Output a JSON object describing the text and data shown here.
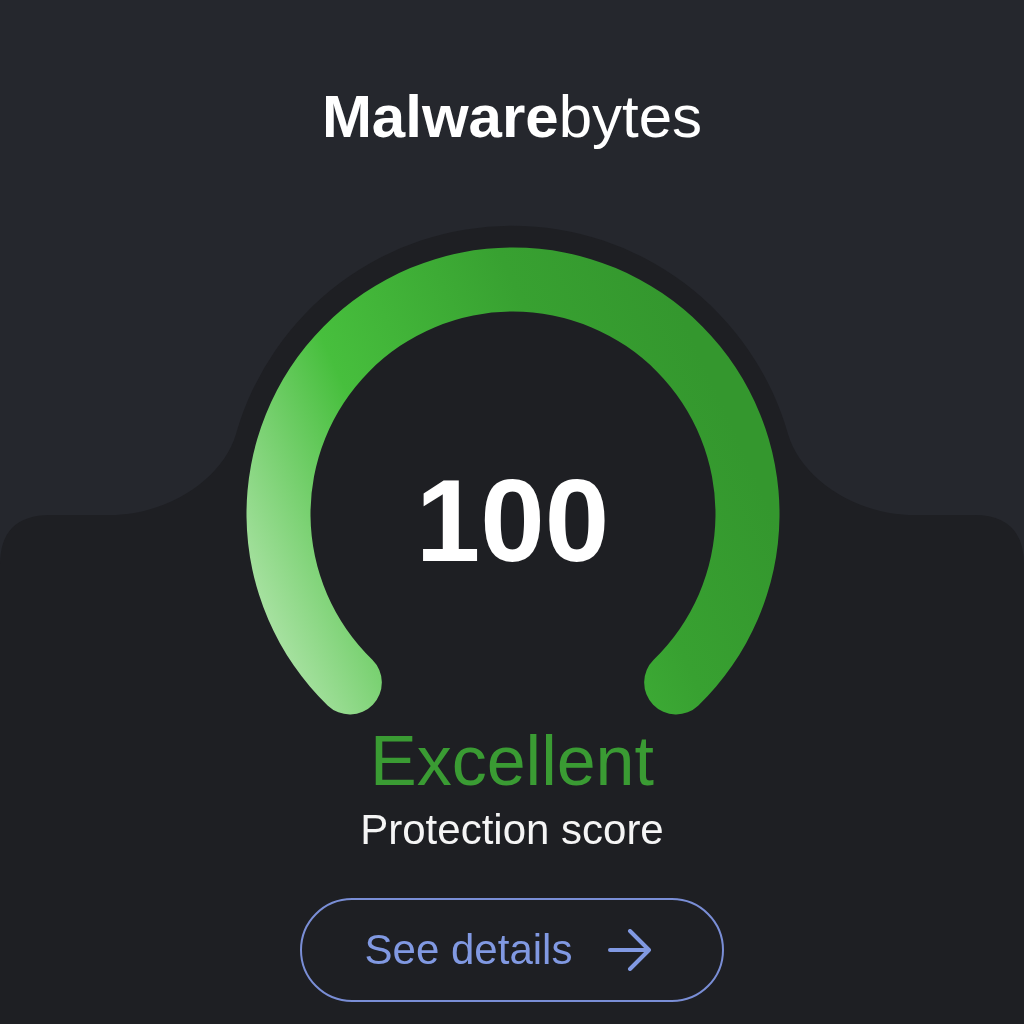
{
  "logo": {
    "wordmark": "**Malware**bytes"
  },
  "gauge": {
    "level": 1,
    "score": "100"
  },
  "rating": "Excellent",
  "caption": "Protection score",
  "details_button": {
    "label": "See details"
  }
}
